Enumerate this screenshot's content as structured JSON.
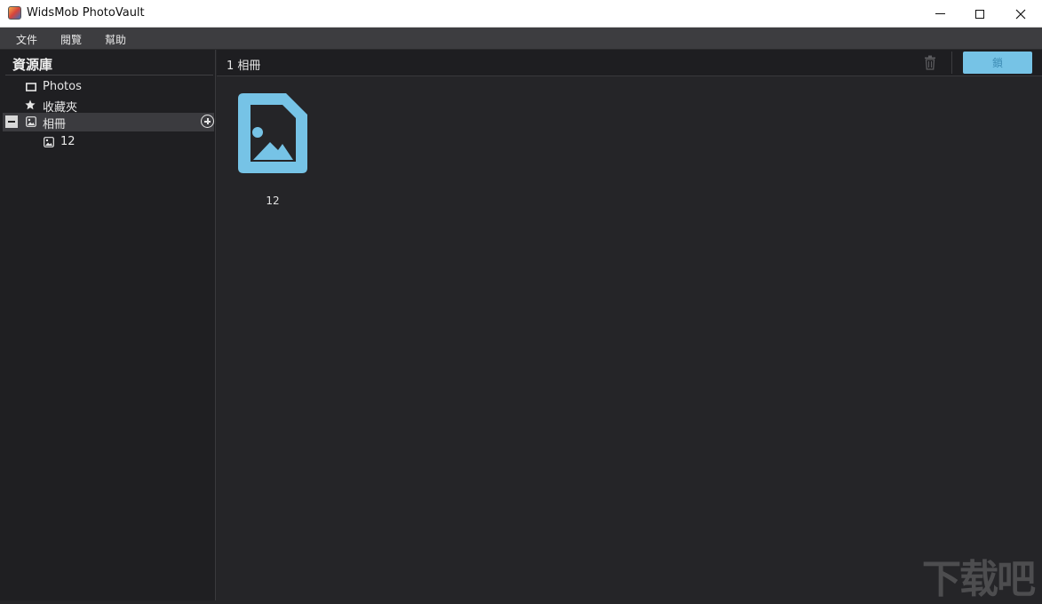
{
  "window": {
    "title": "WidsMob PhotoVault"
  },
  "menu": {
    "items": [
      "文件",
      "閱覽",
      "幫助"
    ]
  },
  "sidebar": {
    "title": "資源庫",
    "items": [
      {
        "label": "Photos",
        "icon": "photo-frame-icon"
      },
      {
        "label": "收藏夾",
        "icon": "star-icon"
      },
      {
        "label": "相冊",
        "icon": "album-icon",
        "selected": true,
        "expanded": true
      },
      {
        "label": "12",
        "icon": "album-icon",
        "child": true
      }
    ]
  },
  "main": {
    "count_label": "1 相冊",
    "primary_button": "鎖",
    "albums": [
      {
        "name": "12",
        "icon": "image-file-icon"
      }
    ]
  },
  "watermark": "下载吧",
  "colors": {
    "accent": "#76c3e6",
    "background": "#252528",
    "sidebar": "#1f1f22"
  }
}
